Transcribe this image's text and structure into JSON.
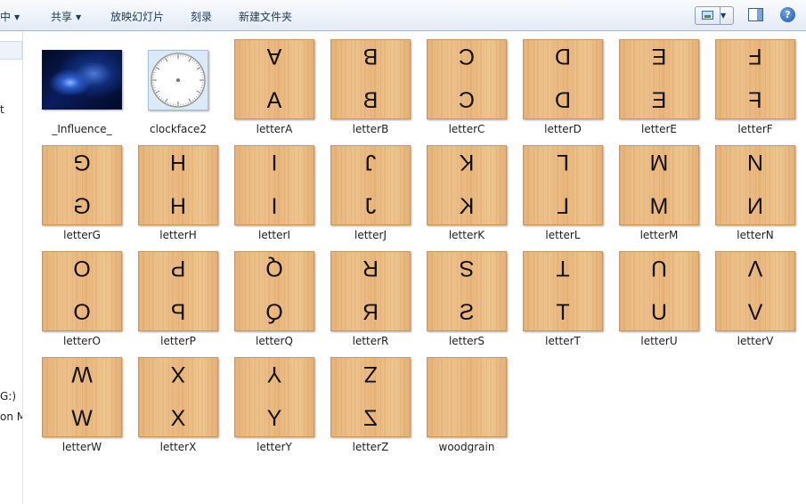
{
  "toolbar": {
    "partial_item": "中",
    "share": "共享",
    "slideshow": "放映幻灯片",
    "burn": "刻录",
    "new_folder": "新建文件夹",
    "help_glyph": "?"
  },
  "nav": {
    "fragments": [
      "t",
      "G:)",
      "on M"
    ]
  },
  "items": [
    {
      "name": "_Influence_",
      "type": "image",
      "icon": "influence-thumbnail"
    },
    {
      "name": "clockface2",
      "type": "image",
      "icon": "clockface-thumbnail"
    },
    {
      "name": "letterA",
      "type": "letter",
      "glyph": "A"
    },
    {
      "name": "letterB",
      "type": "letter",
      "glyph": "B"
    },
    {
      "name": "letterC",
      "type": "letter",
      "glyph": "C"
    },
    {
      "name": "letterD",
      "type": "letter",
      "glyph": "D"
    },
    {
      "name": "letterE",
      "type": "letter",
      "glyph": "E"
    },
    {
      "name": "letterF",
      "type": "letter",
      "glyph": "F"
    },
    {
      "name": "letterG",
      "type": "letter",
      "glyph": "G"
    },
    {
      "name": "letterH",
      "type": "letter",
      "glyph": "H"
    },
    {
      "name": "letterI",
      "type": "letter",
      "glyph": "I"
    },
    {
      "name": "letterJ",
      "type": "letter",
      "glyph": "J"
    },
    {
      "name": "letterK",
      "type": "letter",
      "glyph": "K"
    },
    {
      "name": "letterL",
      "type": "letter",
      "glyph": "L"
    },
    {
      "name": "letterM",
      "type": "letter",
      "glyph": "M"
    },
    {
      "name": "letterN",
      "type": "letter",
      "glyph": "N"
    },
    {
      "name": "letterO",
      "type": "letter",
      "glyph": "O"
    },
    {
      "name": "letterP",
      "type": "letter",
      "glyph": "P"
    },
    {
      "name": "letterQ",
      "type": "letter",
      "glyph": "Q"
    },
    {
      "name": "letterR",
      "type": "letter",
      "glyph": "R"
    },
    {
      "name": "letterS",
      "type": "letter",
      "glyph": "S"
    },
    {
      "name": "letterT",
      "type": "letter",
      "glyph": "T"
    },
    {
      "name": "letterU",
      "type": "letter",
      "glyph": "U"
    },
    {
      "name": "letterV",
      "type": "letter",
      "glyph": "V"
    },
    {
      "name": "letterW",
      "type": "letter",
      "glyph": "W"
    },
    {
      "name": "letterX",
      "type": "letter",
      "glyph": "X"
    },
    {
      "name": "letterY",
      "type": "letter",
      "glyph": "Y"
    },
    {
      "name": "letterZ",
      "type": "letter",
      "glyph": "Z"
    },
    {
      "name": "woodgrain",
      "type": "wood"
    }
  ]
}
